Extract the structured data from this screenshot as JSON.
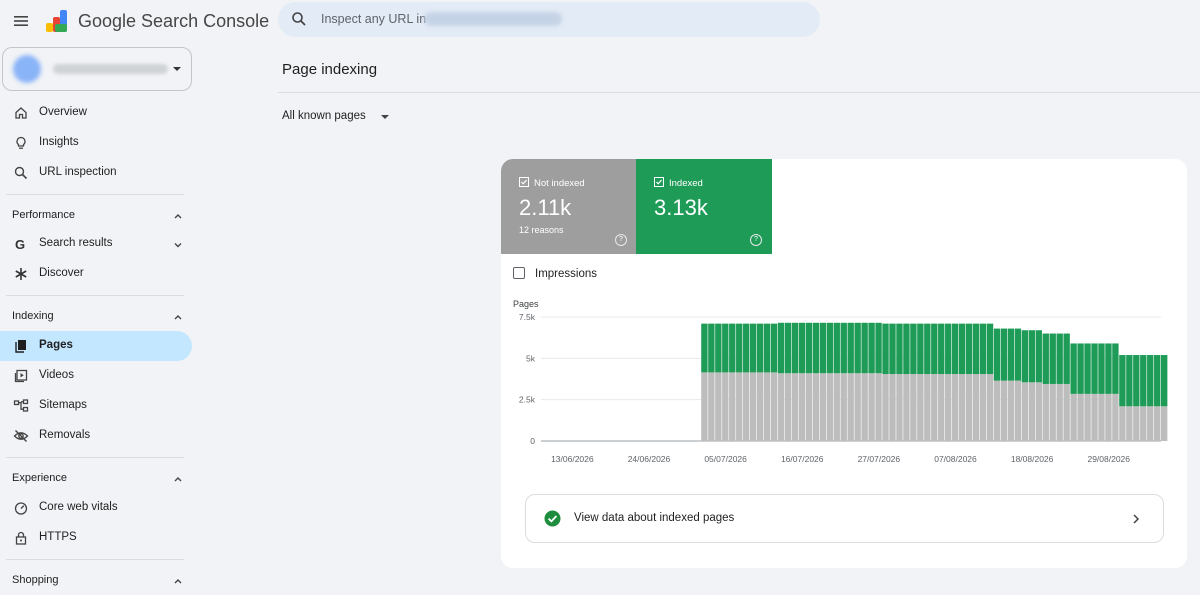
{
  "header": {
    "app_title": "Google Search Console",
    "search_placeholder": "Inspect any URL in",
    "menu_icon": "hamburger-icon",
    "search_icon": "search-icon"
  },
  "sidebar": {
    "top_items": [
      {
        "label": "Overview",
        "icon": "home-icon"
      },
      {
        "label": "Insights",
        "icon": "lightbulb-icon"
      },
      {
        "label": "URL inspection",
        "icon": "search-icon"
      }
    ],
    "sections": {
      "performance": {
        "title": "Performance",
        "items": [
          {
            "label": "Search results",
            "icon": "google-g-icon"
          },
          {
            "label": "Discover",
            "icon": "asterisk-icon"
          }
        ]
      },
      "indexing": {
        "title": "Indexing",
        "items": [
          {
            "label": "Pages",
            "icon": "pages-icon"
          },
          {
            "label": "Videos",
            "icon": "video-icon"
          },
          {
            "label": "Sitemaps",
            "icon": "sitemap-icon"
          },
          {
            "label": "Removals",
            "icon": "eye-off-icon"
          }
        ]
      },
      "experience": {
        "title": "Experience",
        "items": [
          {
            "label": "Core web vitals",
            "icon": "gauge-icon"
          },
          {
            "label": "HTTPS",
            "icon": "lock-icon"
          }
        ]
      },
      "shopping": {
        "title": "Shopping"
      }
    }
  },
  "main": {
    "title": "Page indexing",
    "filter_label": "All known pages",
    "tiles": {
      "not_indexed": {
        "label": "Not indexed",
        "value": "2.11k",
        "sub": "12 reasons",
        "help": "?"
      },
      "indexed": {
        "label": "Indexed",
        "value": "3.13k",
        "help": "?"
      }
    },
    "impressions_label": "Impressions",
    "view_data_label": "View data about indexed pages"
  },
  "colors": {
    "not_indexed": "#bdbdbd",
    "indexed": "#1e9b57",
    "tile_not_indexed": "#9e9e9e",
    "active_nav": "#c2e7ff",
    "search_bg": "#e3ebf6"
  },
  "chart_data": {
    "type": "bar",
    "stacked": true,
    "ylabel": "Pages",
    "y_ticks": [
      "0",
      "2.5k",
      "5k",
      "7.5k"
    ],
    "ylim": [
      0,
      7500
    ],
    "x_tick_labels": [
      "13/06/2026",
      "24/06/2026",
      "05/07/2026",
      "16/07/2026",
      "27/07/2026",
      "07/08/2026",
      "18/08/2026",
      "29/08/2026"
    ],
    "x_start": "2026-06-09",
    "x_end": "2026-09-06",
    "grid": true,
    "segments": [
      {
        "from": "2026-07-02",
        "to": "2026-07-12",
        "not_indexed": 4150,
        "indexed": 2950
      },
      {
        "from": "2026-07-13",
        "to": "2026-07-27",
        "not_indexed": 4100,
        "indexed": 3050
      },
      {
        "from": "2026-07-28",
        "to": "2026-08-12",
        "not_indexed": 4050,
        "indexed": 3050
      },
      {
        "from": "2026-08-13",
        "to": "2026-08-16",
        "not_indexed": 3650,
        "indexed": 3150
      },
      {
        "from": "2026-08-17",
        "to": "2026-08-19",
        "not_indexed": 3550,
        "indexed": 3150
      },
      {
        "from": "2026-08-20",
        "to": "2026-08-23",
        "not_indexed": 3450,
        "indexed": 3050
      },
      {
        "from": "2026-08-24",
        "to": "2026-08-30",
        "not_indexed": 2850,
        "indexed": 3050
      },
      {
        "from": "2026-08-31",
        "to": "2026-09-06",
        "not_indexed": 2100,
        "indexed": 3100
      }
    ]
  }
}
